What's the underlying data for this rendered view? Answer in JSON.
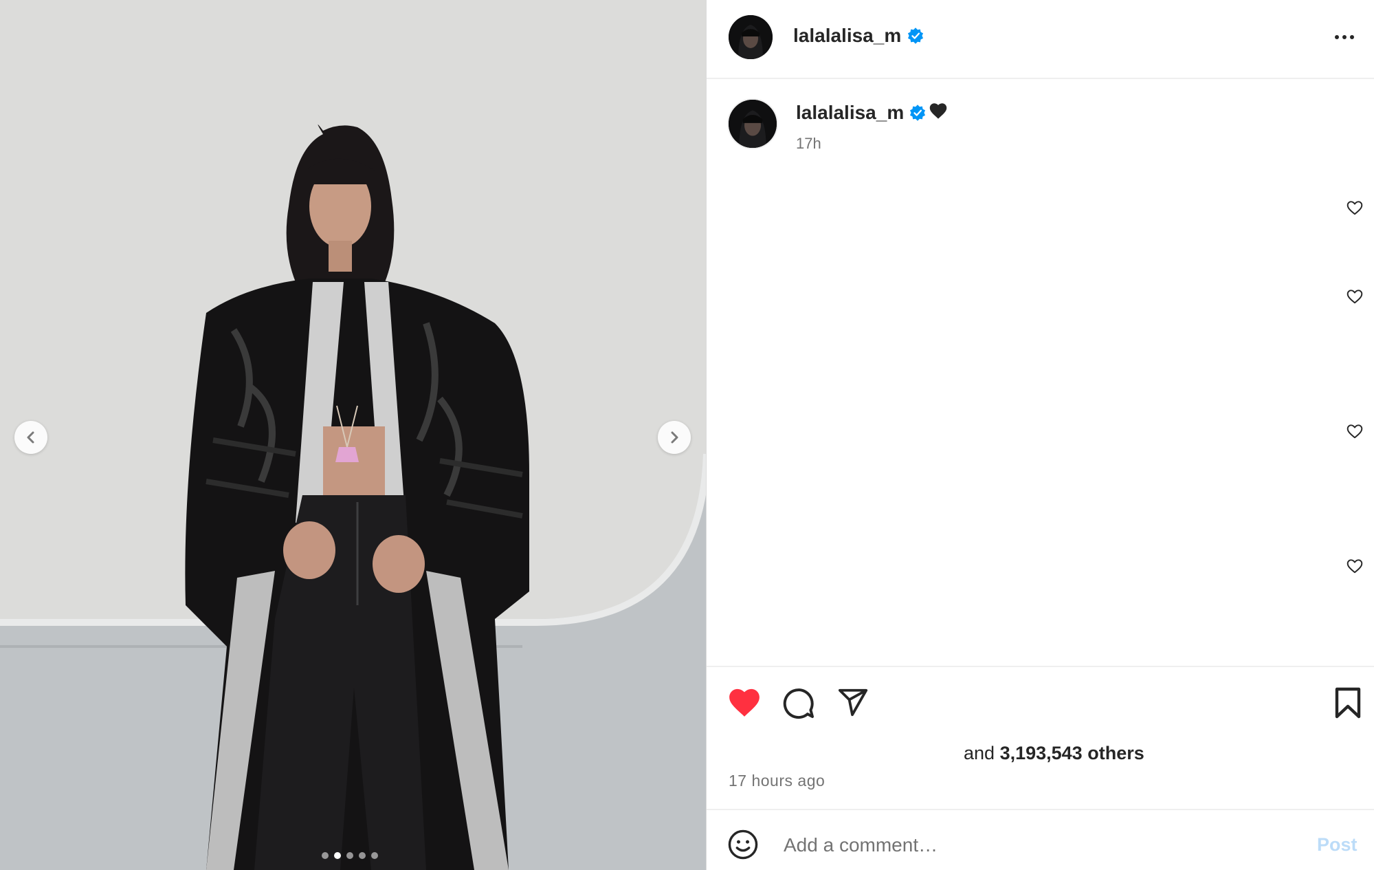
{
  "post": {
    "username": "lalalalisa_m",
    "more_options_icon": "ellipsis-icon",
    "verified_icon": "verified-badge-icon",
    "accent_color": "#0095f6",
    "like_active_color": "#ff3040"
  },
  "media": {
    "slides_total": 5,
    "slide_active_index": 2,
    "prev_icon": "chevron-left-icon",
    "next_icon": "chevron-right-icon"
  },
  "caption": {
    "username": "lalalalisa_m",
    "text": "🖤",
    "time": "17h"
  },
  "comments": {
    "like_icon": "heart-outline-icon",
    "visible_like_buttons": 4
  },
  "actions": {
    "like_icon": "heart-filled-icon",
    "comment_icon": "comment-icon",
    "share_icon": "send-icon",
    "save_icon": "bookmark-icon",
    "likes_prefix": "and",
    "likes_count": "3,193,543",
    "likes_suffix": "others",
    "posted_ago": "17 hours ago"
  },
  "composer": {
    "emoji_icon": "smiley-icon",
    "placeholder": "Add a comment…",
    "post_label": "Post"
  }
}
